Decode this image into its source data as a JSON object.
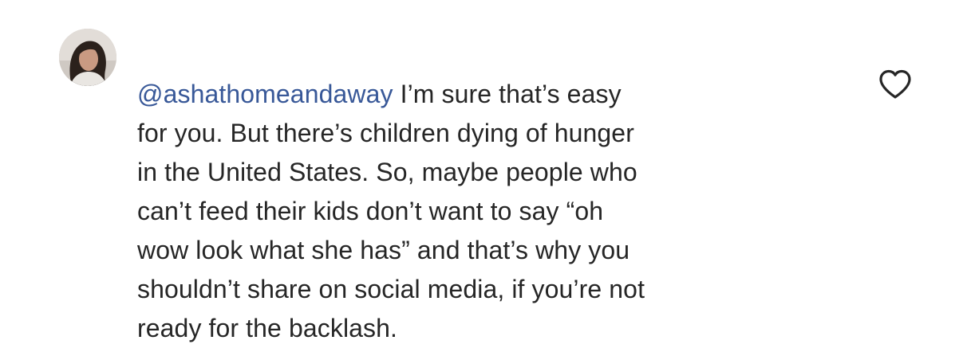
{
  "comment": {
    "mention": "@ashathomeandaway",
    "lines": [
      " I’m sure that’s easy",
      "for you. But there’s children dying of hunger",
      "in the United States. So, maybe people who",
      "can’t feed their kids don’t want to say “oh",
      "wow look what she has” and that’s why you",
      "shouldn’t share on social media, if you’re not",
      "ready for the backlash."
    ],
    "colors": {
      "text": "#262626",
      "mention": "#385898"
    }
  },
  "icons": {
    "like": "heart-outline-icon",
    "avatar": "profile-photo"
  }
}
